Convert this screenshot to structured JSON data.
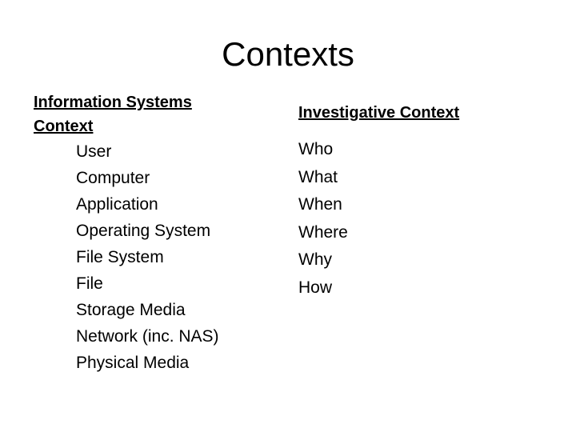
{
  "slide": {
    "title": "Contexts",
    "left_column": {
      "heading": "Information Systems Context",
      "items": [
        "User",
        "Computer",
        "Application",
        "Operating System",
        "File System",
        "File",
        "Storage Media",
        "Network (inc. NAS)",
        "Physical Media"
      ]
    },
    "right_column": {
      "heading": "Investigative Context",
      "items": [
        "Who",
        "What",
        "When",
        "Where",
        "Why",
        "How"
      ]
    }
  }
}
